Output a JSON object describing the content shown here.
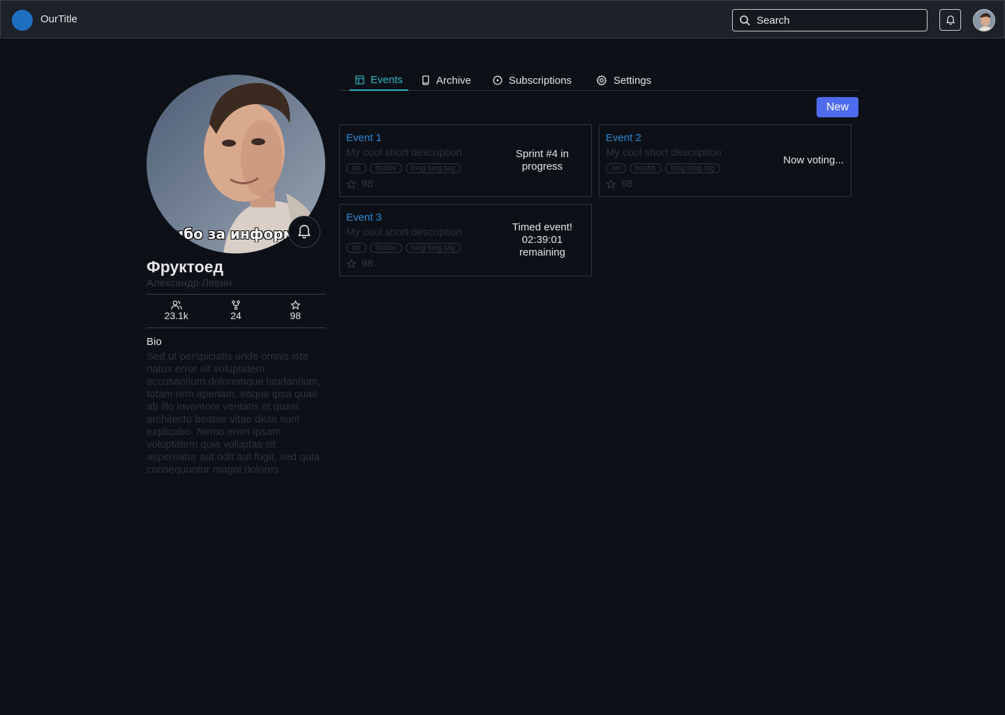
{
  "app": {
    "title": "OurTitle",
    "search_placeholder": "Search",
    "colors": {
      "background": "#0d1117",
      "topbar": "#1c212a",
      "accent_tab": "#2fb7c4",
      "primary_button": "#4f6bed",
      "link": "#2b88d8",
      "logo": "#1f6fc1"
    }
  },
  "profile": {
    "avatar_caption": "пасибо за информацию",
    "name": "Фруктоед",
    "subname": "Александр Левин",
    "stats": [
      {
        "icon": "users-icon",
        "value": "23.1k"
      },
      {
        "icon": "fork-icon",
        "value": "24"
      },
      {
        "icon": "star-icon",
        "value": "98"
      }
    ],
    "bio_title": "Bio",
    "bio_text": "Sed ut perspiciatis unde omnis iste natus error sit voluptatem accusantium doloremque laudantium, totam rem aperiam, eaque ipsa quae ab illo inventore veritatis et quasi architecto beatae vitae dicta sunt explicabo. Nemo enim ipsam voluptatem quia voluptas sit aspernatur aut odit aut fugit, sed quia consequuntur magni dolores"
  },
  "tabs": [
    {
      "label": "Events",
      "icon": "table-icon",
      "active": true
    },
    {
      "label": "Archive",
      "icon": "book-icon",
      "active": false
    },
    {
      "label": "Subscriptions",
      "icon": "circle-dot-icon",
      "active": false
    },
    {
      "label": "Settings",
      "icon": "gear-icon",
      "active": false
    }
  ],
  "new_button": "New",
  "events": [
    {
      "title": "Event 1",
      "description": "My cool short description",
      "tags": [
        "art",
        "boobs",
        "long long tag"
      ],
      "rating": "98",
      "status": "Sprint #4 in progress"
    },
    {
      "title": "Event 2",
      "description": "My cool short description",
      "tags": [
        "art",
        "boobs",
        "long long tag"
      ],
      "rating": "98",
      "status": "Now voting..."
    },
    {
      "title": "Event 3",
      "description": "My cool short description",
      "tags": [
        "art",
        "boobs",
        "long long tag"
      ],
      "rating": "98",
      "status": "Timed event! 02:39:01 remaining"
    }
  ]
}
